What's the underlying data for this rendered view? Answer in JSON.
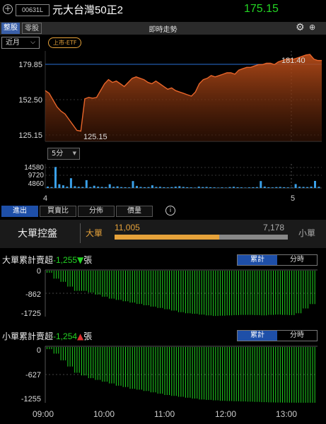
{
  "header": {
    "stock_code": "00631L",
    "stock_name": "元大台灣50正2",
    "price": "175.15",
    "price_color": "#23d423"
  },
  "tabs": {
    "tab1": "整股",
    "tab2": "零股",
    "title": "即時走勢",
    "icons": [
      "add-icon",
      "gear-icon",
      "expand-icon"
    ]
  },
  "controls": {
    "range_select": "近月",
    "etf_badge": "上市-ETF",
    "interval_select": "5分"
  },
  "price_chart": {
    "y_ticks": [
      "179.85",
      "152.50",
      "125.15"
    ],
    "high_label": "181.40",
    "low_label": "125.15",
    "x_labels": [
      "4",
      "5"
    ]
  },
  "volume_chart": {
    "y_ticks": [
      "14580",
      "9720",
      "4860"
    ]
  },
  "bottom_tabs": [
    "進出",
    "買賣比",
    "分佈",
    "價量"
  ],
  "control_panel": {
    "label": "大單控盤",
    "big_label": "大單",
    "big_value": "11,005",
    "small_value": "7,178",
    "small_label": "小單",
    "big_share": 0.605
  },
  "big_section": {
    "title": "大單累計賣超",
    "value": "-1,255",
    "unit": "張",
    "y_ticks": [
      "0",
      "-862",
      "-1725"
    ],
    "seg_on": "累計",
    "seg_off": "分時"
  },
  "small_section": {
    "title": "小單累計賣超",
    "value": "-1,254",
    "unit": "張",
    "y_ticks": [
      "0",
      "-627",
      "-1255"
    ],
    "seg_on": "累計",
    "seg_off": "分時"
  },
  "time_axis": [
    "09:00",
    "10:00",
    "11:00",
    "12:00",
    "13:00"
  ],
  "chart_data": [
    {
      "type": "area",
      "ylim": [
        118,
        184
      ],
      "x": [
        0,
        1,
        2,
        3,
        4,
        5,
        6,
        7,
        8,
        9,
        10,
        11,
        12,
        13,
        14,
        15,
        16,
        17,
        18,
        19,
        20,
        21,
        22,
        23,
        24,
        25,
        26,
        27,
        28,
        29,
        30,
        31,
        32,
        33,
        34,
        35,
        36,
        37,
        38,
        39,
        40,
        41,
        42,
        43,
        44,
        45,
        46,
        47,
        48,
        49,
        50,
        51,
        52,
        53,
        54,
        55,
        56,
        57,
        58,
        59,
        60,
        61,
        62,
        63,
        64,
        65,
        66,
        67,
        68,
        69,
        70
      ],
      "values": [
        155,
        153,
        148,
        143,
        140,
        138,
        134,
        130,
        126,
        125.5,
        149,
        150,
        149.5,
        150,
        155,
        160,
        163,
        161,
        162,
        160,
        158,
        161,
        164,
        165,
        164,
        163,
        161,
        160,
        162,
        160,
        158,
        156,
        157,
        155,
        154,
        153,
        152,
        151,
        154,
        160,
        163,
        164,
        166,
        165,
        166,
        167,
        168,
        168,
        167,
        170,
        171,
        172,
        172,
        173,
        174,
        174,
        175,
        175,
        174,
        176,
        177,
        178,
        178,
        178,
        179,
        180,
        181,
        181.4,
        178,
        177,
        177
      ],
      "series": [
        {
          "name": "",
          "values": []
        }
      ]
    },
    {
      "type": "bar",
      "ylim": [
        0,
        16000
      ],
      "values": [
        900,
        600,
        14000,
        2500,
        1800,
        900,
        6500,
        1200,
        800,
        700,
        5200,
        600,
        1500,
        900,
        700,
        600,
        2500,
        800,
        1100,
        600,
        500,
        400,
        4600,
        1300,
        700,
        500,
        600,
        1800,
        700,
        800,
        500,
        400,
        600,
        900,
        1200,
        700,
        500,
        400,
        300,
        900,
        600,
        700,
        500,
        400,
        300,
        400,
        300,
        600,
        800,
        500,
        400,
        300,
        400,
        500,
        600,
        4600,
        900,
        500,
        400,
        600,
        700,
        500,
        400,
        300,
        2600,
        800,
        700,
        600,
        900,
        4700,
        800
      ]
    },
    {
      "type": "bar",
      "title": "大單累計賣超",
      "ylim": [
        -1725,
        0
      ],
      "values": [
        -80,
        -300,
        -420,
        -600,
        -760,
        -760,
        -820,
        -900,
        -980,
        -1050,
        -1100,
        -1150,
        -1200,
        -1250,
        -1300,
        -1350,
        -1400,
        -1450,
        -1500,
        -1560,
        -1600,
        -1620,
        -1650,
        -1680,
        -1700,
        -1690,
        -1680,
        -1670,
        -1660,
        -1660,
        -1670,
        -1680,
        -1660,
        -1650,
        -1660,
        -1670,
        -1600,
        -1420,
        -1255
      ]
    },
    {
      "type": "bar",
      "title": "小單累計賣超",
      "ylim": [
        -1255,
        0
      ],
      "values": [
        -50,
        -150,
        -300,
        -440,
        -580,
        -640,
        -700,
        -740,
        -780,
        -820,
        -870,
        -900,
        -940,
        -960,
        -990,
        -1020,
        -1050,
        -1080,
        -1100,
        -1120,
        -1140,
        -1160,
        -1180,
        -1190,
        -1200,
        -1210,
        -1215,
        -1220,
        -1225,
        -1230,
        -1235,
        -1240,
        -1245,
        -1248,
        -1250,
        -1252,
        -1253,
        -1254,
        -1254
      ]
    }
  ]
}
